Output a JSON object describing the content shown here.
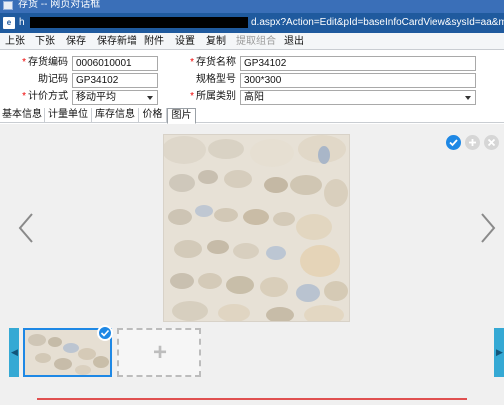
{
  "window": {
    "title": "存货 -- 网页对话框",
    "url_prefix": "h",
    "url_visible": "d.aspx?Action=Edit&pId=baseInfoCardView&sysId=aa&mld"
  },
  "menu": {
    "items": [
      {
        "label": "上张"
      },
      {
        "label": "下张"
      },
      {
        "label": "保存"
      },
      {
        "label": "保存新增"
      },
      {
        "label": "附件"
      },
      {
        "label": "设置"
      },
      {
        "label": "复制"
      },
      {
        "label": "提取组合",
        "disabled": true
      },
      {
        "label": "退出"
      }
    ]
  },
  "form": {
    "code_label": "存货编码",
    "code_value": "0006010001",
    "name_label": "存货名称",
    "name_value": "GP34102",
    "mnemonic_label": "助记码",
    "mnemonic_value": "GP34102",
    "spec_label": "规格型号",
    "spec_value": "300*300",
    "pricing_label": "计价方式",
    "pricing_value": "移动平均",
    "category_label": "所属类别",
    "category_value": "高阳",
    "required_mark": "*"
  },
  "tabs": [
    {
      "label": "基本信息"
    },
    {
      "label": "计量单位"
    },
    {
      "label": "库存信息"
    },
    {
      "label": "价格"
    },
    {
      "label": "图片",
      "active": true
    }
  ],
  "icons": {
    "confirm": "check-circle-icon",
    "add": "plus-circle-icon",
    "remove": "close-circle-icon",
    "prev": "chevron-left-icon",
    "next": "chevron-right-icon",
    "add_image": "plus-icon"
  },
  "colors": {
    "accent": "#1e88e5",
    "handle": "#35a9d4",
    "title_bar": "#1f5a9e"
  }
}
